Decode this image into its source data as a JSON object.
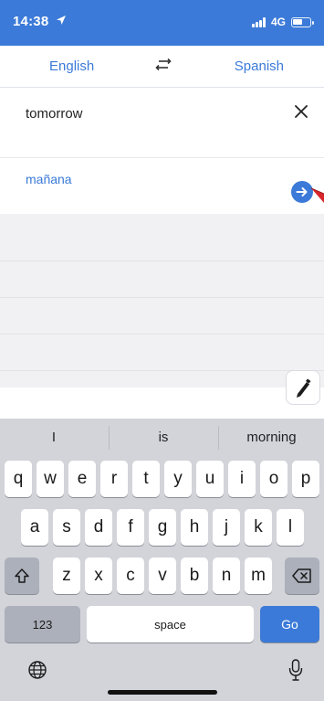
{
  "status": {
    "time": "14:38",
    "network": "4G"
  },
  "languages": {
    "source": "English",
    "target": "Spanish"
  },
  "input": {
    "text": "tomorrow"
  },
  "translation": {
    "text": "mañana"
  },
  "keyboard": {
    "suggestions": [
      "I",
      "is",
      "morning"
    ],
    "row1": [
      "q",
      "w",
      "e",
      "r",
      "t",
      "y",
      "u",
      "i",
      "o",
      "p"
    ],
    "row2": [
      "a",
      "s",
      "d",
      "f",
      "g",
      "h",
      "j",
      "k",
      "l"
    ],
    "row3": [
      "z",
      "x",
      "c",
      "v",
      "b",
      "n",
      "m"
    ],
    "numbers_label": "123",
    "space_label": "space",
    "go_label": "Go"
  },
  "colors": {
    "accent": "#3b7ad8",
    "keyboard_bg": "#d2d4da",
    "history_bg": "#f1f1f3",
    "pointer": "#d7262c"
  },
  "icons": [
    "location-arrow-icon",
    "signal-icon",
    "battery-icon",
    "swap-icon",
    "close-icon",
    "arrow-right-circle-icon",
    "pen-icon",
    "shift-icon",
    "backspace-icon",
    "globe-icon",
    "microphone-icon"
  ]
}
